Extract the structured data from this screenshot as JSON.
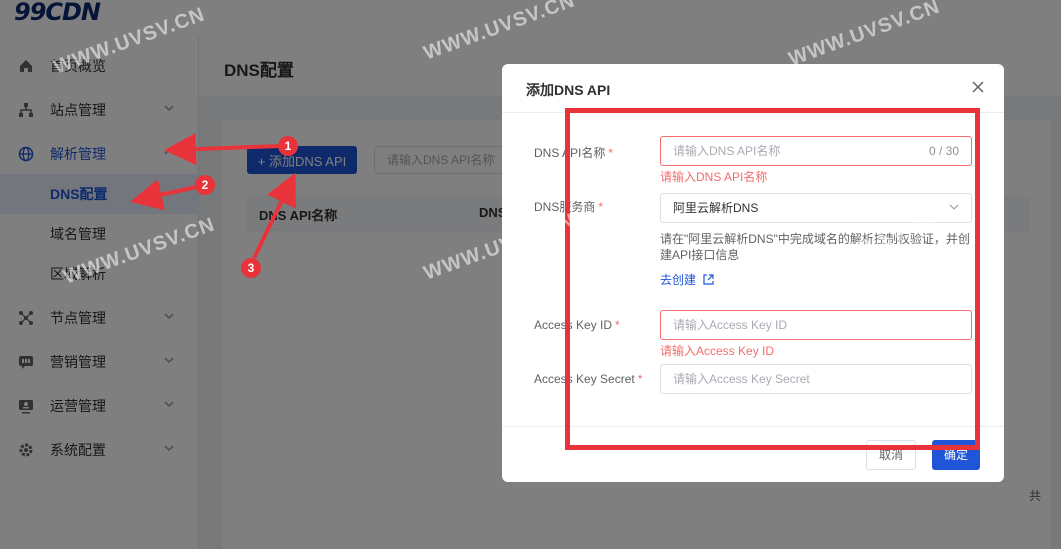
{
  "app": {
    "logo": "99CDN"
  },
  "sidebar": {
    "items": [
      {
        "label": "首页概览",
        "icon": "home-icon"
      },
      {
        "label": "站点管理",
        "icon": "sitemap-icon"
      },
      {
        "label": "解析管理",
        "icon": "globe-icon"
      },
      {
        "label": "节点管理",
        "icon": "nodes-icon"
      },
      {
        "label": "营销管理",
        "icon": "marketing-icon"
      },
      {
        "label": "运营管理",
        "icon": "operations-icon"
      },
      {
        "label": "系统配置",
        "icon": "gear-icon"
      }
    ],
    "sub_items": [
      {
        "label": "DNS配置"
      },
      {
        "label": "域名管理"
      },
      {
        "label": "区域解析"
      }
    ]
  },
  "page": {
    "title": "DNS配置",
    "add_button": "+ 添加DNS API",
    "filter_placeholder": "请输入DNS API名称",
    "table_headers": [
      "DNS API名称",
      "DNS"
    ],
    "total_prefix": "共"
  },
  "dialog": {
    "title": "添加DNS API",
    "fields": {
      "api_name": {
        "label": "DNS API名称",
        "placeholder": "请输入DNS API名称",
        "counter": "0 / 30",
        "error": "请输入DNS API名称"
      },
      "provider": {
        "label": "DNS服务商",
        "value": "阿里云解析DNS",
        "hint": "请在\"阿里云解析DNS\"中完成域名的解析控制权验证，并创建API接口信息",
        "link": "去创建"
      },
      "key_id": {
        "label": "Access Key ID",
        "placeholder": "请输入Access Key ID",
        "error": "请输入Access Key ID"
      },
      "key_secret": {
        "label": "Access Key Secret",
        "placeholder": "请输入Access Key Secret"
      }
    },
    "cancel_label": "取消",
    "confirm_label": "确定"
  },
  "annotations": {
    "badges": [
      "1",
      "2",
      "3"
    ],
    "color": "#e8333a"
  },
  "watermark": "WWW.UVSV.CN"
}
